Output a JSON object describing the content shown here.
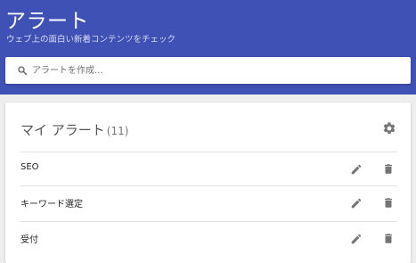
{
  "header": {
    "title": "アラート",
    "subtitle": "ウェブ上の面白い新着コンテンツをチェック",
    "color": "#3f51b5"
  },
  "search": {
    "placeholder": "アラートを作成..."
  },
  "my_alerts": {
    "title": "マイ アラート",
    "count": "(11)",
    "settings_icon": "gear-icon",
    "items": [
      {
        "label": "SEO"
      },
      {
        "label": "キーワード選定"
      },
      {
        "label": "受付"
      }
    ]
  }
}
